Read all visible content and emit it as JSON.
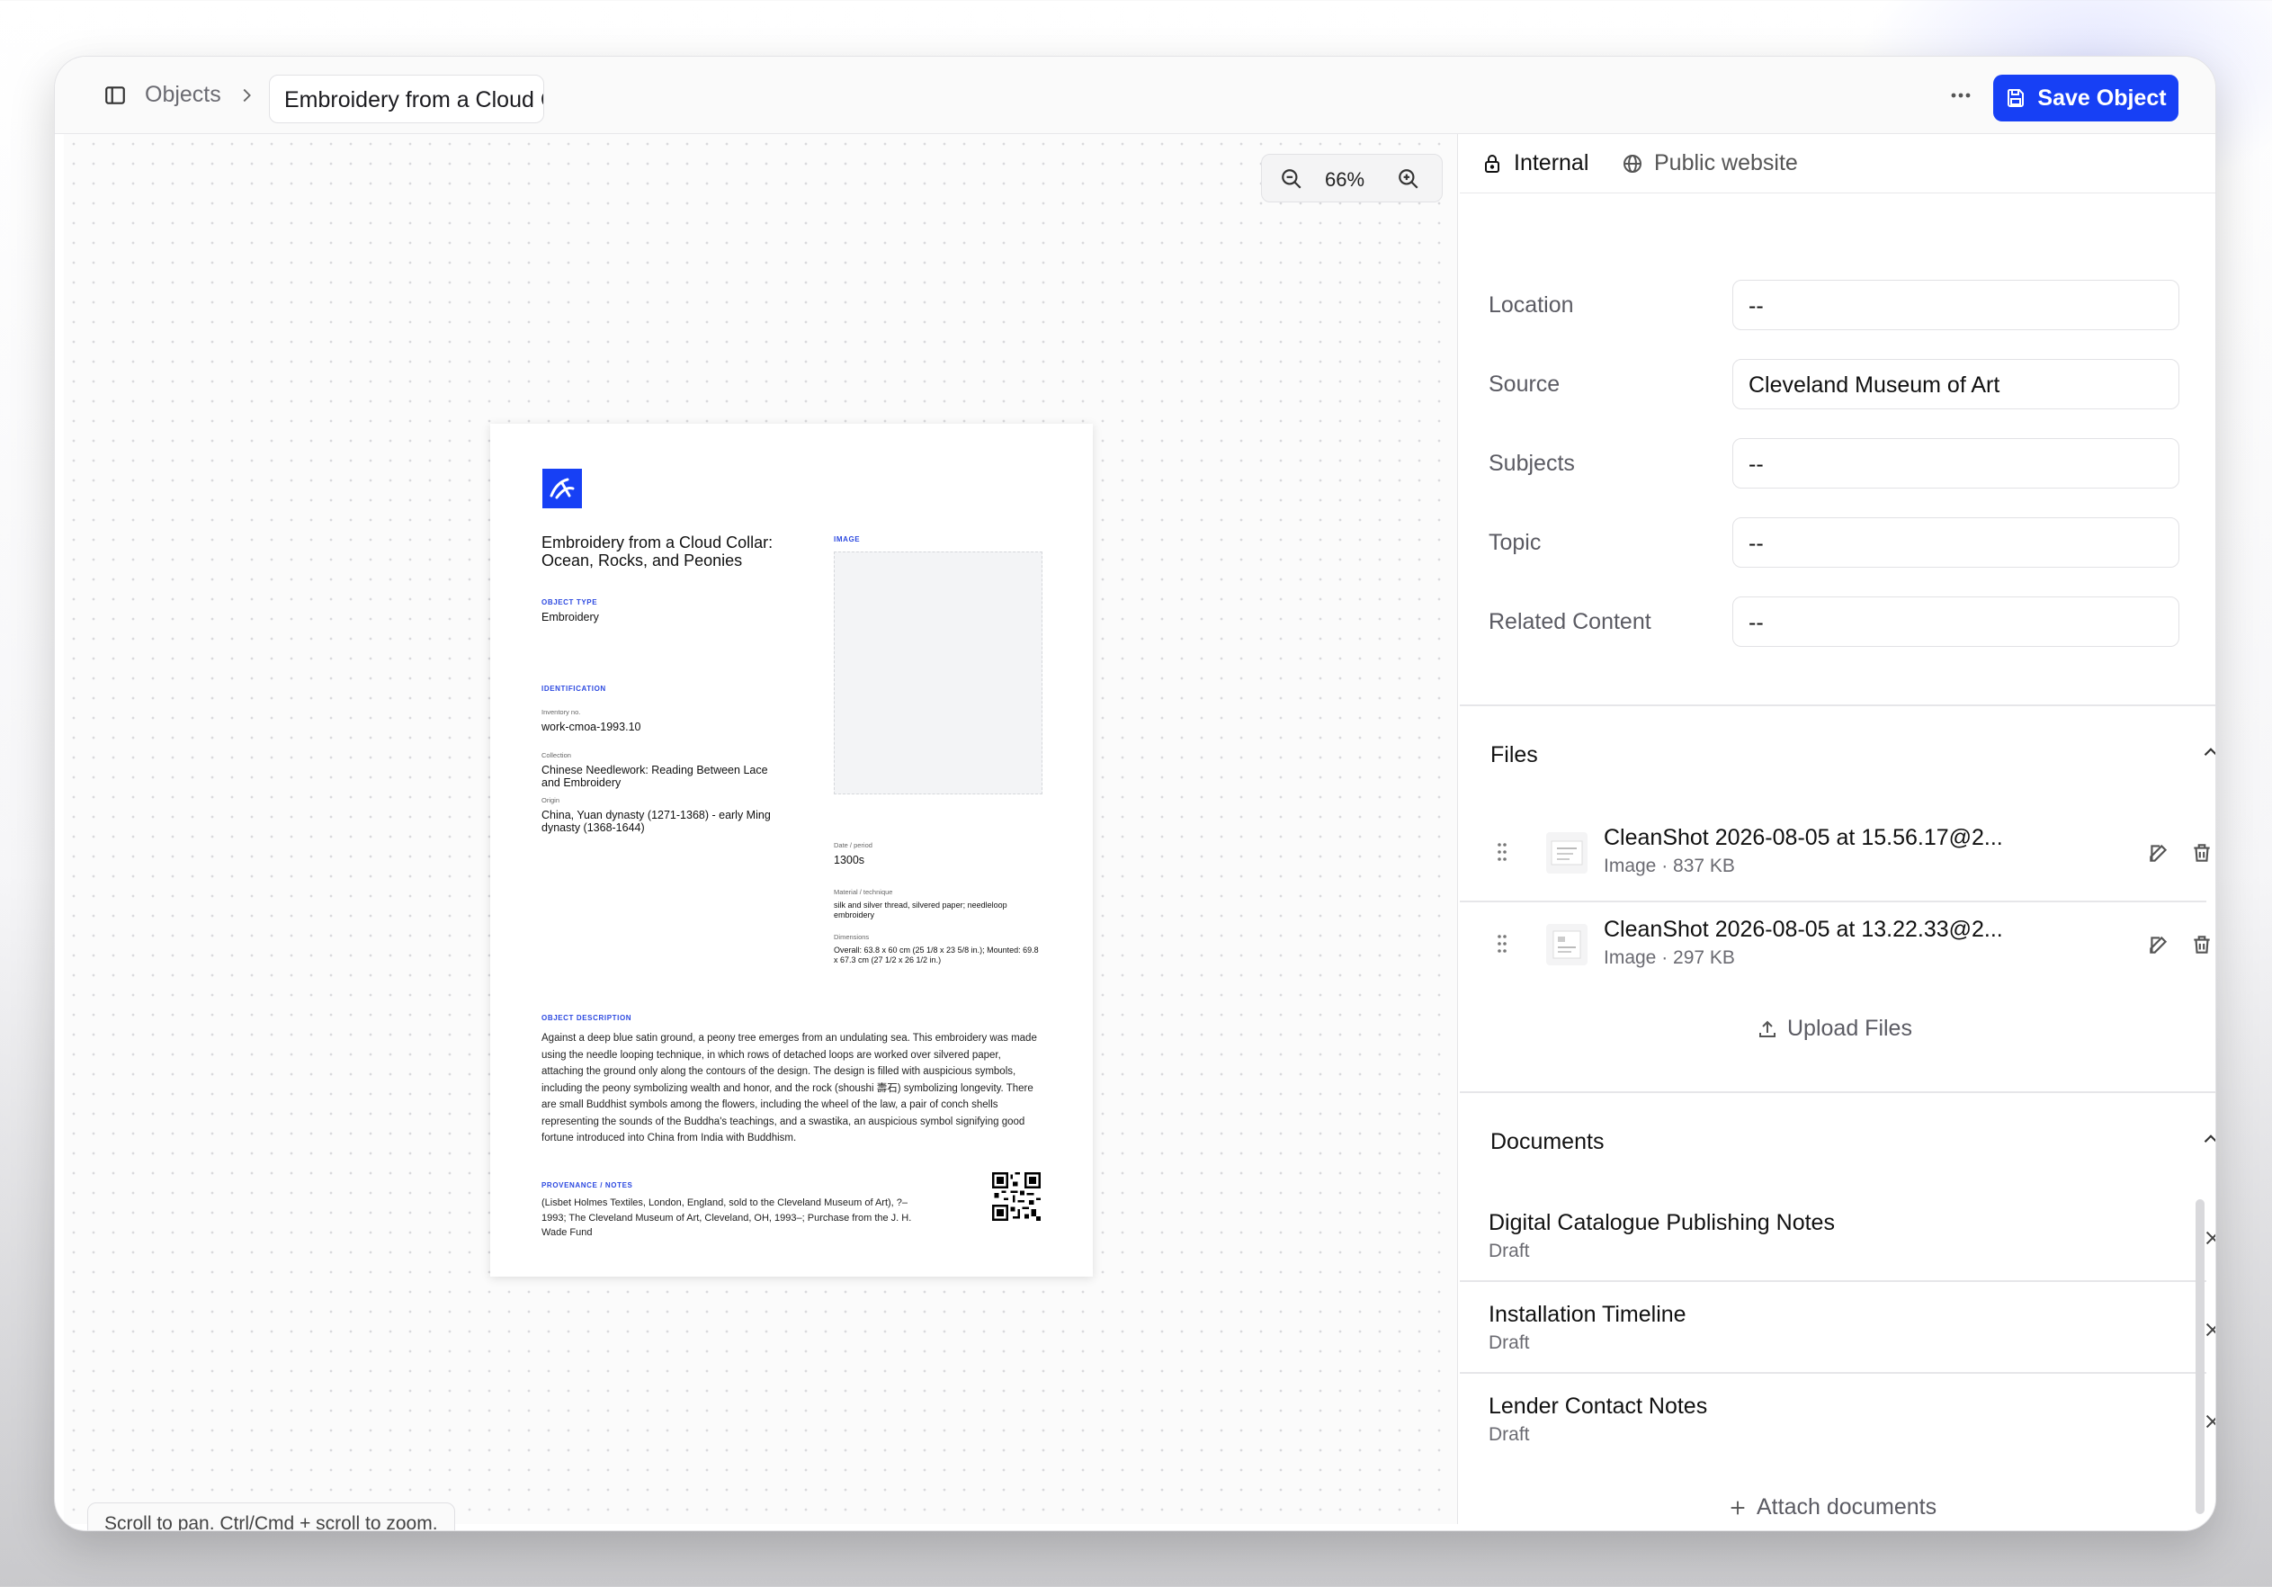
{
  "header": {
    "breadcrumb_root": "Objects",
    "current_title": "Embroidery from a Cloud Collar: Ocean, Rocks, and Peonies",
    "save_label": "Save Object"
  },
  "canvas": {
    "zoom_level": "66%",
    "hint": "Scroll to pan. Ctrl/Cmd + scroll to zoom."
  },
  "document": {
    "title": "Embroidery from a Cloud Collar: Ocean, Rocks, and Peonies",
    "object_type_label": "OBJECT TYPE",
    "object_type": "Embroidery",
    "identification_label": "IDENTIFICATION",
    "inventory_label": "Inventory no.",
    "inventory_no": "work-cmoa-1993.10",
    "collection_label": "Collection",
    "collection": "Chinese Needlework: Reading Between Lace and Embroidery",
    "origin_label": "Origin",
    "origin": "China, Yuan dynasty (1271-1368) - early Ming dynasty (1368-1644)",
    "image_label": "IMAGE",
    "date_label": "Date / period",
    "date": "1300s",
    "material_label": "Material / technique",
    "material": "silk and silver thread, silvered paper; needleloop embroidery",
    "dimensions_label": "Dimensions",
    "dimensions": "Overall: 63.8 x 60 cm (25 1/8 x 23 5/8 in.); Mounted: 69.8 x 67.3 cm (27 1/2 x 26 1/2 in.)",
    "description_label": "OBJECT DESCRIPTION",
    "description": "Against a deep blue satin ground, a peony tree emerges from an undulating sea. This embroidery was made using the needle looping technique, in which rows of detached loops are worked over silvered paper, attaching the ground only along the contours of the design. The design is filled with auspicious symbols, including the peony symbolizing wealth and honor, and the rock (shoushi 壽石) symbolizing longevity. There are small Buddhist symbols among the flowers, including the wheel of the law, a pair of conch shells representing the sounds of the Buddha's teachings, and a swastika, an auspicious symbol signifying good fortune introduced into China from India with Buddhism.",
    "provenance_label": "PROVENANCE / NOTES",
    "provenance": "(Lisbet Holmes Textiles, London, England, sold to the Cleveland Museum of Art), ?–1993; The Cleveland Museum of Art, Cleveland, OH, 1993–; Purchase from the J. H. Wade Fund"
  },
  "panel": {
    "tabs": [
      {
        "label": "Internal",
        "icon": "lock-icon"
      },
      {
        "label": "Public website",
        "icon": "globe-icon"
      }
    ],
    "fields": [
      {
        "label": "Location",
        "value": "--"
      },
      {
        "label": "Source",
        "value": "Cleveland Museum of Art"
      },
      {
        "label": "Subjects",
        "value": "--"
      },
      {
        "label": "Topic",
        "value": "--"
      },
      {
        "label": "Related Content",
        "value": "--"
      }
    ],
    "files_title": "Files",
    "files": [
      {
        "name": "CleanShot 2026-08-05 at 15.56.17@2...",
        "meta": "Image · 837 KB"
      },
      {
        "name": "CleanShot 2026-08-05 at 13.22.33@2...",
        "meta": "Image · 297 KB"
      }
    ],
    "upload_label": "Upload Files",
    "documents_title": "Documents",
    "documents": [
      {
        "name": "Digital Catalogue Publishing Notes",
        "status": "Draft"
      },
      {
        "name": "Installation Timeline",
        "status": "Draft"
      },
      {
        "name": "Lender Contact Notes",
        "status": "Draft"
      }
    ],
    "attach_label": "Attach documents"
  },
  "colors": {
    "accent": "#1740f5",
    "label_blue": "#2c49e0"
  }
}
